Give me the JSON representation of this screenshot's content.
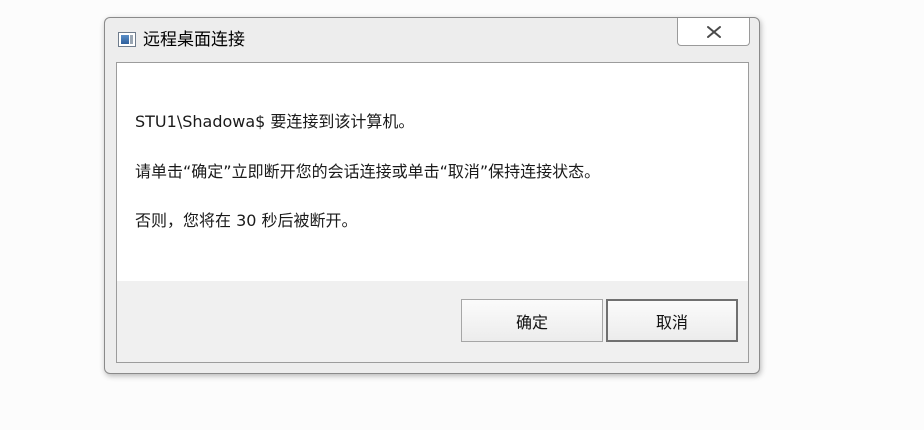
{
  "window": {
    "title": "远程桌面连接",
    "icon": "remote-desktop-icon",
    "close_icon": "close-icon"
  },
  "message": {
    "line1": "STU1\\Shadowa$ 要连接到该计算机。",
    "line2": "请单击“确定”立即断开您的会话连接或单击“取消”保持连接状态。",
    "line3": "否则，您将在 30 秒后被断开。"
  },
  "buttons": {
    "ok_label": "确定",
    "cancel_label": "取消"
  }
}
